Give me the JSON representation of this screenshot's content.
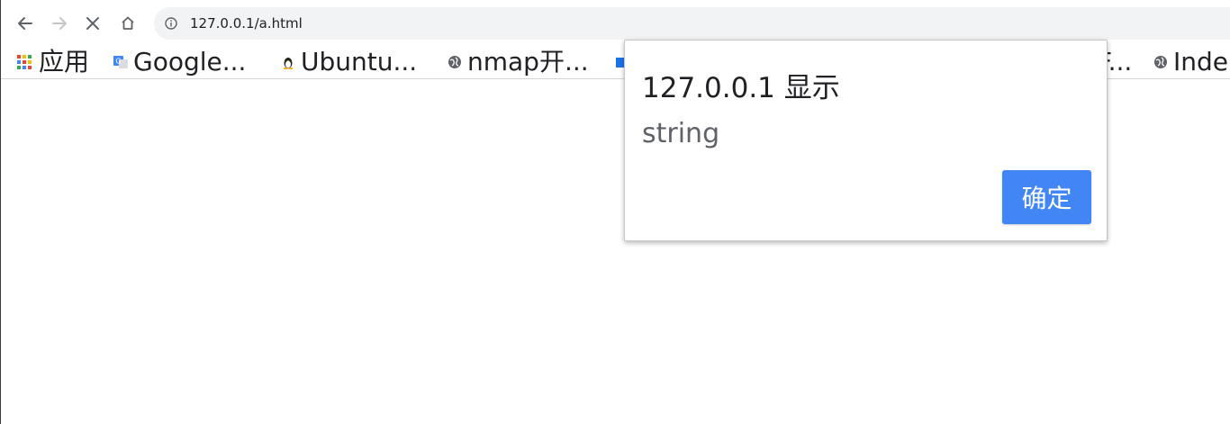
{
  "browser": {
    "url": "127.0.0.1/a.html",
    "buttons": {
      "back": "back-arrow-icon",
      "forward": "forward-arrow-icon",
      "stop": "close-icon",
      "home": "home-icon"
    }
  },
  "bookmarks": {
    "items": [
      {
        "label": "应用",
        "icon": "apps-grid-icon"
      },
      {
        "label": "Google...",
        "icon": "google-translate-icon"
      },
      {
        "label": "Ubuntu...",
        "icon": "tux-icon"
      },
      {
        "label": "nmap开...",
        "icon": "globe-icon"
      },
      {
        "label": "F...",
        "icon": "document-icon"
      },
      {
        "label": "Inde",
        "icon": "globe-icon"
      }
    ]
  },
  "dialog": {
    "title": "127.0.0.1 显示",
    "message": "string",
    "ok_label": "确定"
  },
  "colors": {
    "accent": "#4285f4",
    "omnibox_bg": "#f1f3f4",
    "text": "#202124",
    "muted_text": "#5f6368"
  }
}
